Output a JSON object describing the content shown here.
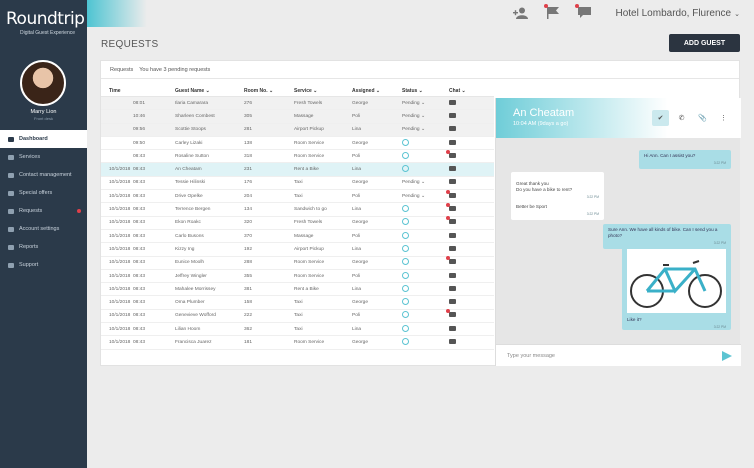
{
  "brand": {
    "name": "Roundtrip",
    "tagline": "Digital Guest Experience"
  },
  "user": {
    "name": "Marry Lion",
    "role": "Front desk"
  },
  "nav": [
    {
      "label": "Dashboard",
      "active": true
    },
    {
      "label": "Services"
    },
    {
      "label": "Contact management"
    },
    {
      "label": "Special offers"
    },
    {
      "label": "Requests",
      "badge": true
    },
    {
      "label": "Account settings"
    },
    {
      "label": "Reports"
    },
    {
      "label": "Support"
    }
  ],
  "topbar": {
    "hotel": "Hotel Lombardo, Flurence"
  },
  "page": {
    "title": "REQUESTS",
    "add_guest": "ADD GUEST"
  },
  "panel": {
    "heading": "Requests",
    "pending": "You have 3 pending requests"
  },
  "columns": {
    "time": "Time",
    "guest": "Guest Name",
    "room": "Room No.",
    "service": "Service",
    "assigned": "Assigned",
    "status": "Status",
    "chat": "Chat"
  },
  "rows": [
    {
      "date": "",
      "time": "08:01",
      "guest": "Ilaria Camarara",
      "room": "276",
      "service": "Fresh Towels",
      "assigned": "George",
      "status": "Pending",
      "unread": false
    },
    {
      "date": "",
      "time": "10:46",
      "guest": "Sharleen Combest",
      "room": "305",
      "service": "Massage",
      "assigned": "Poli",
      "status": "Pending",
      "unread": false
    },
    {
      "date": "",
      "time": "09:56",
      "guest": "Scottie Stoops",
      "room": "281",
      "service": "Airport Pickup",
      "assigned": "Lina",
      "status": "Pending",
      "unread": false
    },
    {
      "date": "",
      "time": "09:50",
      "guest": "Carley Lizaki",
      "room": "138",
      "service": "Room Service",
      "assigned": "George",
      "status": "",
      "unread": false
    },
    {
      "date": "",
      "time": "08:43",
      "guest": "Rosaline Sutton",
      "room": "318",
      "service": "Room Service",
      "assigned": "Poli",
      "status": "",
      "unread": true
    },
    {
      "date": "10/1/2018",
      "time": "08:43",
      "guest": "An Cheatam",
      "room": "231",
      "service": "Rent a Bike",
      "assigned": "Lina",
      "status": "",
      "unread": false
    },
    {
      "date": "10/1/2018",
      "time": "08:43",
      "guest": "Tessie Hilinski",
      "room": "176",
      "service": "Taxi",
      "assigned": "George",
      "status": "Pending",
      "unread": false
    },
    {
      "date": "10/1/2018",
      "time": "08:43",
      "guest": "Drive Opelke",
      "room": "204",
      "service": "Taxi",
      "assigned": "Poli",
      "status": "Pending",
      "unread": true
    },
    {
      "date": "10/1/2018",
      "time": "08:43",
      "guest": "Terrence Bergen",
      "room": "134",
      "service": "Sandwich to go",
      "assigned": "Lina",
      "status": "",
      "unread": true
    },
    {
      "date": "10/1/2018",
      "time": "08:43",
      "guest": "Ekon Roakc",
      "room": "320",
      "service": "Fresh Towels",
      "assigned": "George",
      "status": "",
      "unread": true
    },
    {
      "date": "10/1/2018",
      "time": "08:43",
      "guest": "Carlo Busons",
      "room": "370",
      "service": "Massage",
      "assigned": "Poli",
      "status": "",
      "unread": false
    },
    {
      "date": "10/1/2018",
      "time": "08:43",
      "guest": "Kizzy Ing",
      "room": "192",
      "service": "Airport Pickup",
      "assigned": "Lina",
      "status": "",
      "unread": false
    },
    {
      "date": "10/1/2018",
      "time": "08:43",
      "guest": "Eunice Moolh",
      "room": "288",
      "service": "Room Service",
      "assigned": "George",
      "status": "",
      "unread": true
    },
    {
      "date": "10/1/2018",
      "time": "08:43",
      "guest": "Jeffrey Wingler",
      "room": "355",
      "service": "Room Service",
      "assigned": "Poli",
      "status": "",
      "unread": false
    },
    {
      "date": "10/1/2018",
      "time": "08:43",
      "guest": "Mahalee Morrissey",
      "room": "381",
      "service": "Rent a Bike",
      "assigned": "Lina",
      "status": "",
      "unread": false
    },
    {
      "date": "10/1/2018",
      "time": "08:43",
      "guest": "Oma Plumber",
      "room": "158",
      "service": "Taxi",
      "assigned": "George",
      "status": "",
      "unread": false
    },
    {
      "date": "10/1/2018",
      "time": "08:43",
      "guest": "Genevieve Wofford",
      "room": "222",
      "service": "Taxi",
      "assigned": "Poli",
      "status": "",
      "unread": true
    },
    {
      "date": "10/1/2018",
      "time": "08:43",
      "guest": "Lilian Hoom",
      "room": "362",
      "service": "Taxi",
      "assigned": "Lina",
      "status": "",
      "unread": false
    },
    {
      "date": "10/1/2018",
      "time": "08:43",
      "guest": "Francisca Juarez",
      "room": "181",
      "service": "Room Service",
      "assigned": "George",
      "status": "",
      "unread": false
    }
  ],
  "chat": {
    "name": "An Cheatam",
    "time": "10:04 AM (9days a go)",
    "messages": [
      {
        "dir": "out",
        "text": "Hi Ann. Can I assist you?",
        "ts": "3:22 PM"
      },
      {
        "dir": "in",
        "text": "Great thank you\nDo you have a bike to rent?",
        "ts": "3:22 PM"
      },
      {
        "dir": "in",
        "text": "Better be Sport",
        "ts": "3:22 PM"
      },
      {
        "dir": "out",
        "text": "Sure Ann. We have all kinds of bike. Can I send you a photo?",
        "ts": "3:22 PM"
      },
      {
        "dir": "out",
        "text": "Like it?",
        "ts": "3:22 PM"
      }
    ],
    "placeholder": "Type your message"
  }
}
